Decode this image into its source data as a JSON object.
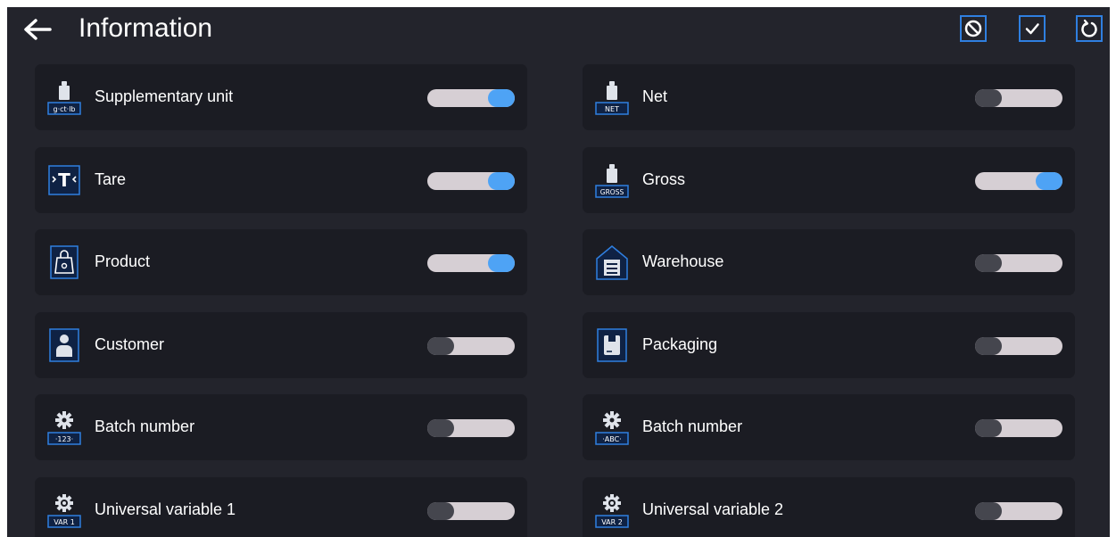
{
  "header": {
    "title": "Information"
  },
  "items": [
    {
      "label": "Supplementary unit",
      "on": true,
      "icon": "weight-unit-icon",
      "icon_text": "g·ct·lb"
    },
    {
      "label": "Net",
      "on": false,
      "icon": "weight-net-icon",
      "icon_text": "NET"
    },
    {
      "label": "Tare",
      "on": true,
      "icon": "tare-icon",
      "icon_text": ""
    },
    {
      "label": "Gross",
      "on": true,
      "icon": "weight-gross-icon",
      "icon_text": "GROSS"
    },
    {
      "label": "Product",
      "on": true,
      "icon": "product-bag-icon",
      "icon_text": ""
    },
    {
      "label": "Warehouse",
      "on": false,
      "icon": "warehouse-icon",
      "icon_text": ""
    },
    {
      "label": "Customer",
      "on": false,
      "icon": "customer-icon",
      "icon_text": ""
    },
    {
      "label": "Packaging",
      "on": false,
      "icon": "packaging-icon",
      "icon_text": ""
    },
    {
      "label": "Batch number",
      "on": false,
      "icon": "batch-number-icon",
      "icon_text": "·123·"
    },
    {
      "label": "Batch number",
      "on": false,
      "icon": "batch-number-icon",
      "icon_text": "·ABC·"
    },
    {
      "label": "Universal variable 1",
      "on": false,
      "icon": "universal-variable-icon",
      "icon_text": "VAR 1"
    },
    {
      "label": "Universal variable 2",
      "on": false,
      "icon": "universal-variable-icon",
      "icon_text": "VAR 2"
    }
  ],
  "colors": {
    "background": "#23242c",
    "tile": "#1b1c23",
    "accent": "#2f7fe0",
    "toggle_on": "#4ea3f5",
    "toggle_track": "#d6cfd4",
    "toggle_off_knob": "#45464e"
  }
}
